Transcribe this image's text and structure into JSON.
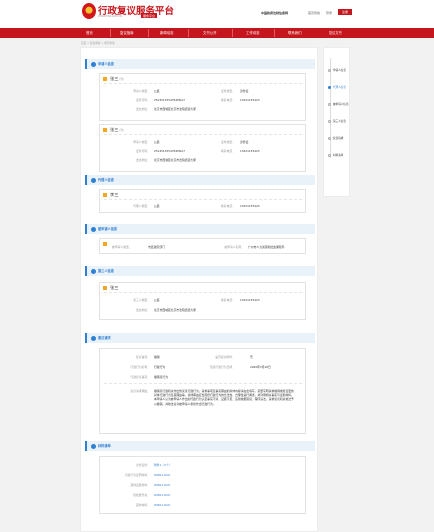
{
  "header": {
    "logo_title": "行政复议服务平台",
    "logo_tag": "服务平台",
    "logo_url": "WWW.MOJ.GOV.CN",
    "links": [
      "中国政府法制信息网",
      "首页导航",
      "登录"
    ],
    "register": "注册"
  },
  "nav": [
    "首页",
    "复议指南",
    "新闻动态",
    "文书公开",
    "工作动态",
    "联系我们"
  ],
  "breadcrumb": "首页 > 复议申请 > 填写申请",
  "sidebar": {
    "title": "复议文书",
    "items": [
      "申请人信息",
      "代理人信息",
      "被申请人信息",
      "第三人信息",
      "复议请求",
      "材料清单"
    ],
    "active": 1
  },
  "applicant": {
    "title": "申请人信息",
    "persons": [
      {
        "name": "张三",
        "tag": "(男)",
        "type_label": "申请人类型：",
        "type": "公民",
        "idtype_label": "证件类型：",
        "idtype": "身份证",
        "idno_label": "证件号码：",
        "idno": "2514513554354MSA7",
        "phone_label": "联系电话：",
        "phone": "13421155423",
        "addr_label": "送达地址：",
        "addr": "北京市西城区北京市法院街道大厦"
      },
      {
        "name": "张三",
        "tag": "(男)",
        "type_label": "申请人类型：",
        "type": "公民",
        "idtype_label": "证件类型：",
        "idtype": "身份证",
        "idno_label": "证件号码：",
        "idno": "2514513554354MSA7",
        "phone_label": "联系电话：",
        "phone": "13421155423",
        "addr_label": "送达地址：",
        "addr": "北京市西城区北京市法院街道大厦"
      }
    ]
  },
  "agent": {
    "title": "代理人信息",
    "name": "李三",
    "type_label": "代理人类型：",
    "type": "公民",
    "phone_label": "联系电话：",
    "phone": "13421155423"
  },
  "respondent": {
    "title": "被申请人信息",
    "type_label": "被申请人类型：",
    "type": "市县政府部门",
    "name_label": "被申请人名称：",
    "name": "广州市人力资源和社会保障局"
  },
  "third": {
    "title": "第三人信息",
    "name": "张三",
    "type_label": "第三人类型：",
    "type": "公民",
    "phone_label": "联系电话：",
    "phone": "13421155423",
    "addr_label": "送达地址：",
    "addr": "北京市西城区北京市法院街道大厦"
  },
  "request": {
    "title": "复议请求",
    "case_label": "复议事项：",
    "case": "撤销",
    "mat_label": "是否提交附件：",
    "mat": "否",
    "act_label": "行政行为名称：",
    "act": "行政行为",
    "date_label": "知道行政行为日期：",
    "date": "2020年3月18日",
    "sub_label": "行政复议事项：",
    "sub": "撤销某行为",
    "reason_label": "复议请求理由：",
    "reason": "撤销某行政机关作出的某某行政行为。请求事项及事实理由的具体内容请在此填写，需要写明请求撤销或者变更的具体行政行为及其理由等。具体理由应当围绕行政行为的合法性、合理性进行阐述，并列明相关事实与证据材料。本申请人认为被申请人作出的行政行为认定事实不清、证据不足、适用依据错误、程序违法，请求复议机关依法予以撤销，并依法责令被申请人重新作出行政行为。"
  },
  "materials": {
    "title": "材料清单",
    "rows": [
      {
        "label": "身份证件：",
        "value": "附件1（2个）"
      },
      {
        "label": "行政行为证明材料：",
        "value": "WIN11.DOC"
      },
      {
        "label": "其他证据材料：",
        "value": "WIN11.DOC"
      },
      {
        "label": "授权委托书：",
        "value": "WIN11.DOC"
      },
      {
        "label": "其他材料：",
        "value": "WIN11.DOC"
      }
    ]
  },
  "colors": {
    "brand": "#c4161c",
    "accent": "#2f7fd3"
  }
}
